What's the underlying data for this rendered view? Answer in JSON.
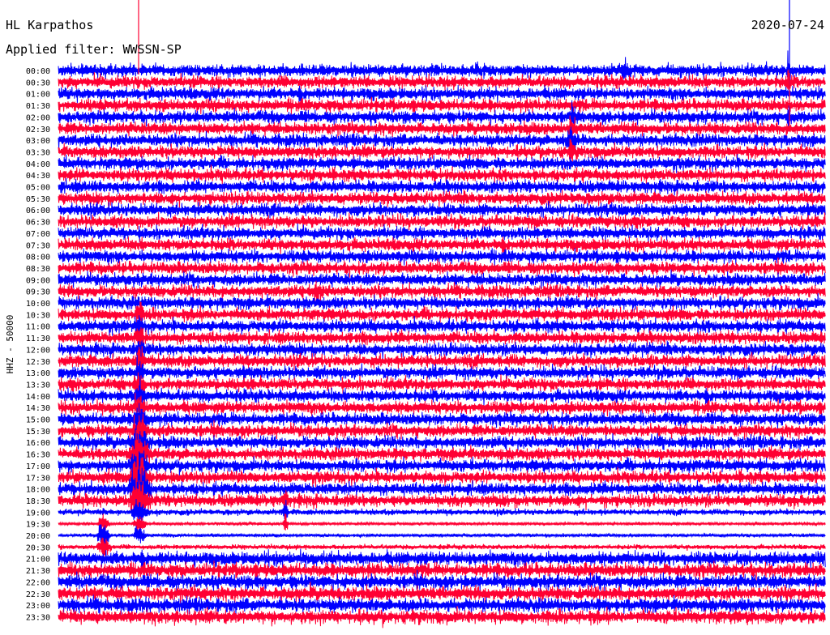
{
  "header": {
    "station": "HL Karpathos",
    "date": "2020-07-24",
    "filter": "Applied filter: WWSSN-SP"
  },
  "axis": {
    "channel_label": "HHZ - 50000"
  },
  "colors": {
    "trace_a": "#0000ff",
    "trace_b": "#ff0033",
    "text": "#000000",
    "background": "#ffffff"
  },
  "chart_data": {
    "type": "line",
    "title": "HL Karpathos",
    "subtitle": "Applied filter: WWSSN-SP",
    "date": "2020-07-24",
    "ylabel": "HHZ - 50000",
    "xlabel": "",
    "grid": false,
    "row_colors_alternate": [
      "#0000ff",
      "#ff0033"
    ],
    "rows": [
      "00:00",
      "00:30",
      "01:00",
      "01:30",
      "02:00",
      "02:30",
      "03:00",
      "03:30",
      "04:00",
      "04:30",
      "05:00",
      "05:30",
      "06:00",
      "06:30",
      "07:00",
      "07:30",
      "08:00",
      "08:30",
      "09:00",
      "09:30",
      "10:00",
      "10:30",
      "11:00",
      "11:30",
      "12:00",
      "12:30",
      "13:00",
      "13:30",
      "14:00",
      "14:30",
      "15:00",
      "15:30",
      "16:00",
      "16:30",
      "17:00",
      "17:30",
      "18:00",
      "18:30",
      "19:00",
      "19:30",
      "20:00",
      "20:30",
      "21:00",
      "21:30",
      "22:00",
      "22:30",
      "23:00",
      "23:30"
    ]
  }
}
